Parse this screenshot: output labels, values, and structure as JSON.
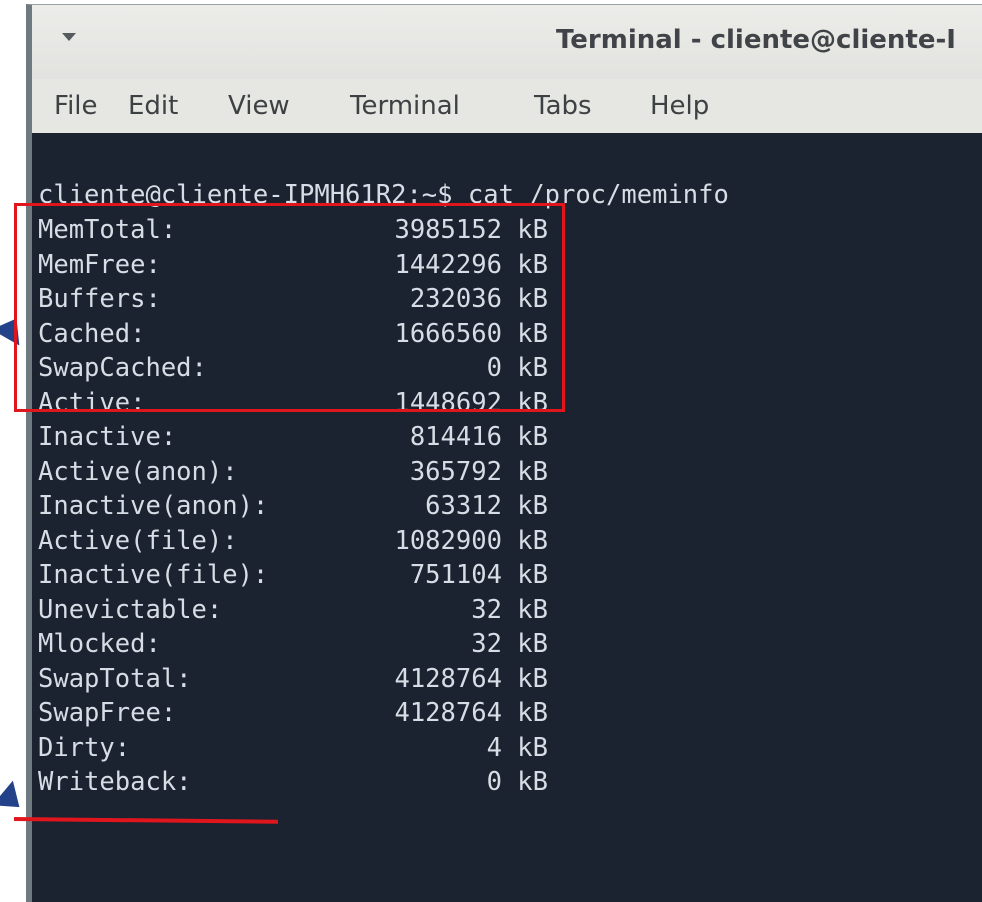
{
  "window": {
    "title": "Terminal - cliente@cliente-I",
    "menu_icon": "chevron-down-icon"
  },
  "menubar": {
    "items": [
      {
        "label": "File"
      },
      {
        "label": "Edit"
      },
      {
        "label": "View"
      },
      {
        "label": "Terminal"
      },
      {
        "label": "Tabs"
      },
      {
        "label": "Help"
      }
    ]
  },
  "terminal": {
    "prompt_line": "cliente@cliente-IPMH61R2:~$ cat /proc/meminfo",
    "rows": [
      {
        "key": "MemTotal:",
        "value": "3985152 kB"
      },
      {
        "key": "MemFree:",
        "value": "1442296 kB"
      },
      {
        "key": "Buffers:",
        "value": "232036 kB"
      },
      {
        "key": "Cached:",
        "value": "1666560 kB"
      },
      {
        "key": "SwapCached:",
        "value": "0 kB"
      },
      {
        "key": "Active:",
        "value": "1448692 kB"
      },
      {
        "key": "Inactive:",
        "value": "814416 kB"
      },
      {
        "key": "Active(anon):",
        "value": "365792 kB"
      },
      {
        "key": "Inactive(anon):",
        "value": "63312 kB"
      },
      {
        "key": "Active(file):",
        "value": "1082900 kB"
      },
      {
        "key": "Inactive(file):",
        "value": "751104 kB"
      },
      {
        "key": "Unevictable:",
        "value": "32 kB"
      },
      {
        "key": "Mlocked:",
        "value": "32 kB"
      },
      {
        "key": "SwapTotal:",
        "value": "4128764 kB"
      },
      {
        "key": "SwapFree:",
        "value": "4128764 kB"
      },
      {
        "key": "Dirty:",
        "value": "4 kB"
      },
      {
        "key": "Writeback:",
        "value": "0 kB"
      }
    ]
  },
  "annotations": {
    "highlight_color": "#e0161c",
    "arrow_color": "#24428a"
  }
}
